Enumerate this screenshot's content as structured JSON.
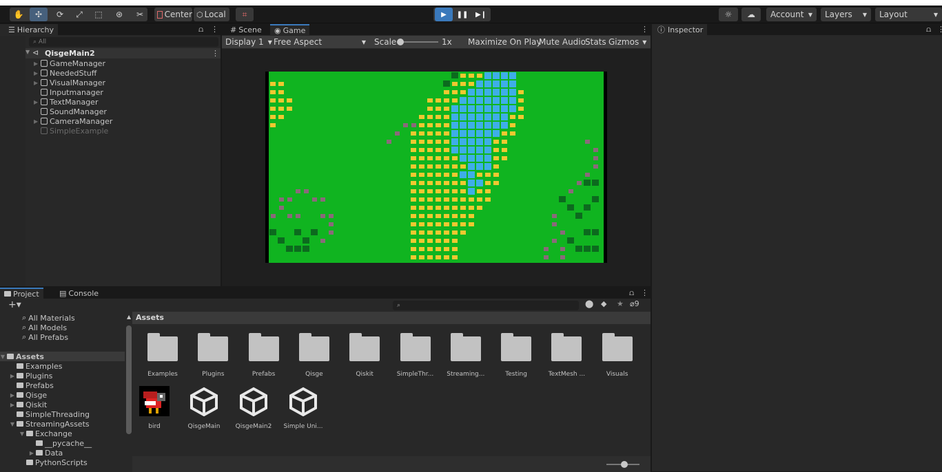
{
  "toolbar": {
    "pivot_label": "Center",
    "space_label": "Local",
    "account_label": "Account",
    "layers_label": "Layers",
    "layout_label": "Layout"
  },
  "hierarchy": {
    "tab_label": "Hierarchy",
    "search_placeholder": "All",
    "scene_name": "QisgeMain2",
    "items": [
      {
        "label": "GameManager",
        "expandable": true,
        "dim": false
      },
      {
        "label": "NeededStuff",
        "expandable": true,
        "dim": false
      },
      {
        "label": "VisualManager",
        "expandable": true,
        "dim": false
      },
      {
        "label": "Inputmanager",
        "expandable": false,
        "dim": false
      },
      {
        "label": "TextManager",
        "expandable": true,
        "dim": false
      },
      {
        "label": "SoundManager",
        "expandable": false,
        "dim": false
      },
      {
        "label": "CameraManager",
        "expandable": true,
        "dim": false
      },
      {
        "label": "SimpleExample",
        "expandable": false,
        "dim": true
      }
    ]
  },
  "game_view": {
    "scene_tab": "Scene",
    "game_tab": "Game",
    "display": "Display 1",
    "aspect": "Free Aspect",
    "scale_label": "Scale",
    "scale_value": "1x",
    "maximize": "Maximize On Play",
    "mute": "Mute Audio",
    "stats": "Stats",
    "gizmos": "Gizmos"
  },
  "inspector": {
    "tab_label": "Inspector"
  },
  "project": {
    "project_tab": "Project",
    "console_tab": "Console",
    "hidden_count": "9",
    "favorites": [
      "All Materials",
      "All Models",
      "All Prefabs"
    ],
    "breadcrumb": "Assets",
    "tree": [
      {
        "label": "Assets",
        "depth": 0,
        "bold": true,
        "open": true,
        "arrow": true
      },
      {
        "label": "Examples",
        "depth": 1,
        "arrow": false
      },
      {
        "label": "Plugins",
        "depth": 1,
        "arrow": true
      },
      {
        "label": "Prefabs",
        "depth": 1,
        "arrow": false
      },
      {
        "label": "Qisge",
        "depth": 1,
        "arrow": true
      },
      {
        "label": "Qiskit",
        "depth": 1,
        "arrow": true
      },
      {
        "label": "SimpleThreading",
        "depth": 1,
        "arrow": false
      },
      {
        "label": "StreamingAssets",
        "depth": 1,
        "arrow": true,
        "open": true
      },
      {
        "label": "Exchange",
        "depth": 2,
        "arrow": true,
        "open": true
      },
      {
        "label": "__pycache__",
        "depth": 3,
        "arrow": false
      },
      {
        "label": "Data",
        "depth": 3,
        "arrow": true
      },
      {
        "label": "PythonScripts",
        "depth": 2,
        "arrow": false
      }
    ],
    "folders": [
      "Examples",
      "Plugins",
      "Prefabs",
      "Qisge",
      "Qiskit",
      "SimpleThr...",
      "Streaming...",
      "Testing",
      "TextMesh ...",
      "Visuals"
    ],
    "files": [
      {
        "label": "bird",
        "kind": "sprite"
      },
      {
        "label": "QisgeMain",
        "kind": "unity"
      },
      {
        "label": "QisgeMain2",
        "kind": "unity"
      },
      {
        "label": "Simple Uni...",
        "kind": "unity"
      }
    ]
  },
  "colors": {
    "accent": "#3a79bb",
    "grass": "#10b420",
    "water": "#3eaee8",
    "sand": "#f0c830",
    "tree": "#0c6a1e",
    "rock": "#8a6a7a"
  }
}
